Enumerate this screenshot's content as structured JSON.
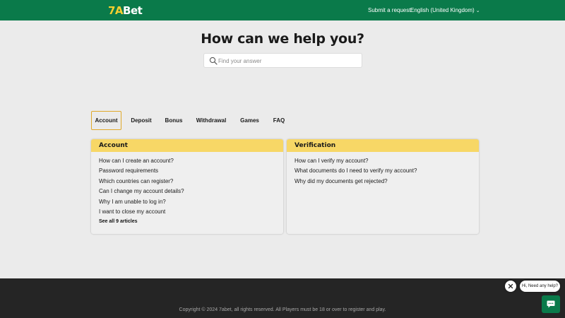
{
  "header": {
    "logo_part1": "7A",
    "logo_part2": "Bet",
    "submit_request_label": "Submit a request",
    "language_label": "English (United Kingdom)",
    "language_icon": "chevron-down-icon",
    "background_color": "#0a7a4a"
  },
  "hero": {
    "title": "How can we help you?",
    "search_placeholder": "Find your answer",
    "search_value": "",
    "search_icon": "search-icon"
  },
  "tabs": [
    {
      "label": "Account",
      "active": true
    },
    {
      "label": "Deposit",
      "active": false
    },
    {
      "label": "Bonus",
      "active": false
    },
    {
      "label": "Withdrawal",
      "active": false
    },
    {
      "label": "Games",
      "active": false
    },
    {
      "label": "FAQ",
      "active": false
    }
  ],
  "sections": [
    {
      "title": "Account",
      "articles": [
        "How can I create an account?",
        "Password requirements",
        "Which countries can register?",
        "Can I change my account details?",
        "Why I am unable to log in?",
        "I want to close my account"
      ],
      "see_all_label": "See all 9 articles"
    },
    {
      "title": "Verification",
      "articles": [
        "How can I verify my account?",
        "What documents do I need to verify my account?",
        "Why did my documents get rejected?"
      ]
    }
  ],
  "footer": {
    "copyright": "Copyright © 2024 7abet, all rights reserved. All Players must be 18 or over to register and play."
  },
  "chat_widget": {
    "greeting": "Hi, Need any help?",
    "close_icon": "close-icon",
    "chat_icon": "chat-icon"
  },
  "colors": {
    "brand_green": "#0a7a4a",
    "brand_yellow": "#f5cf2f",
    "section_header": "#f7d766",
    "active_tab_border": "#e0a92a",
    "footer": "#252525"
  }
}
